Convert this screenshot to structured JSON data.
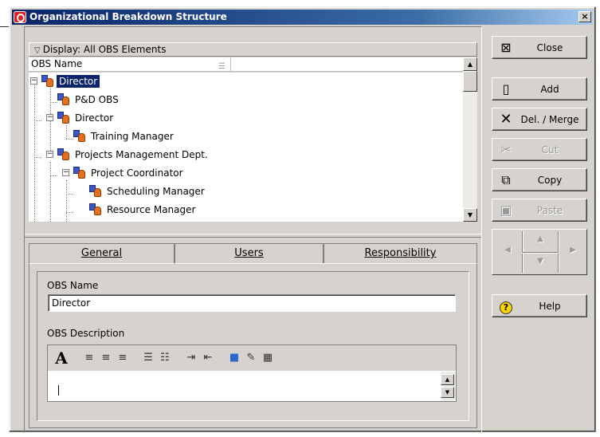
{
  "window": {
    "title": "Organizational Breakdown Structure",
    "close_glyph": "×"
  },
  "display": {
    "label": "Display: All OBS Elements"
  },
  "tree": {
    "column_header": "OBS Name",
    "rows": [
      {
        "label": "Director",
        "selected": true
      },
      {
        "label": "P&D OBS"
      },
      {
        "label": "Director"
      },
      {
        "label": "Training Manager"
      },
      {
        "label": "Projects Management Dept."
      },
      {
        "label": "Project Coordinator"
      },
      {
        "label": "Scheduling Manager"
      },
      {
        "label": "Resource Manager"
      }
    ]
  },
  "tabs": [
    {
      "label": "General",
      "active": true
    },
    {
      "label": "Users"
    },
    {
      "label": "Responsibility"
    }
  ],
  "general": {
    "obs_name_label": "OBS Name",
    "obs_name_value": "Director",
    "obs_description_label": "OBS Description"
  },
  "editor_toolbar": {
    "font_glyph": "A",
    "align_left": "≡",
    "align_center": "≡",
    "align_right": "≡",
    "bullets": "☰",
    "numbered": "☷",
    "indent": "⇥",
    "outdent": "⇤",
    "color": "■",
    "link": "✎",
    "table": "▦"
  },
  "buttons": {
    "close": "Close",
    "add": "Add",
    "del_merge": "Del. / Merge",
    "cut": "Cut",
    "copy": "Copy",
    "paste": "Paste",
    "help": "Help"
  },
  "icons": {
    "close": "window-close-icon",
    "add": "new-document-icon",
    "del_merge": "delete-x-icon",
    "cut": "scissors-icon",
    "copy": "copy-icon",
    "paste": "paste-icon",
    "help": "help-question-icon"
  },
  "colors": {
    "title_bar": "#0a246a",
    "selection": "#0a246a",
    "face": "#d6d3ce",
    "node_blue": "#3b57c4",
    "node_orange": "#e7701c"
  }
}
